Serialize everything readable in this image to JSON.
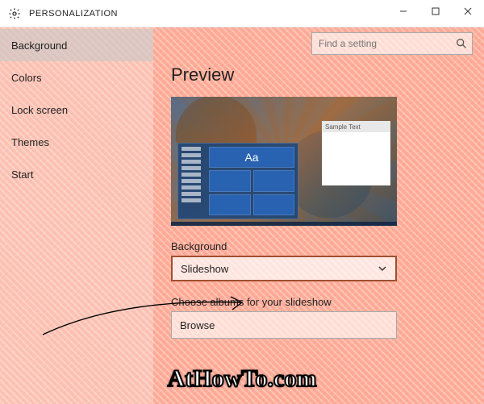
{
  "window": {
    "title": "PERSONALIZATION"
  },
  "search": {
    "placeholder": "Find a setting"
  },
  "sidebar": {
    "items": [
      {
        "label": "Background",
        "selected": true
      },
      {
        "label": "Colors",
        "selected": false
      },
      {
        "label": "Lock screen",
        "selected": false
      },
      {
        "label": "Themes",
        "selected": false
      },
      {
        "label": "Start",
        "selected": false
      }
    ]
  },
  "content": {
    "preview_heading": "Preview",
    "preview_tile_glyph": "Aa",
    "preview_window_title": "Sample Text",
    "bg_label": "Background",
    "bg_value": "Slideshow",
    "albums_label": "Choose albums for your slideshow",
    "browse_label": "Browse"
  },
  "watermark": "AtHowTo.com"
}
